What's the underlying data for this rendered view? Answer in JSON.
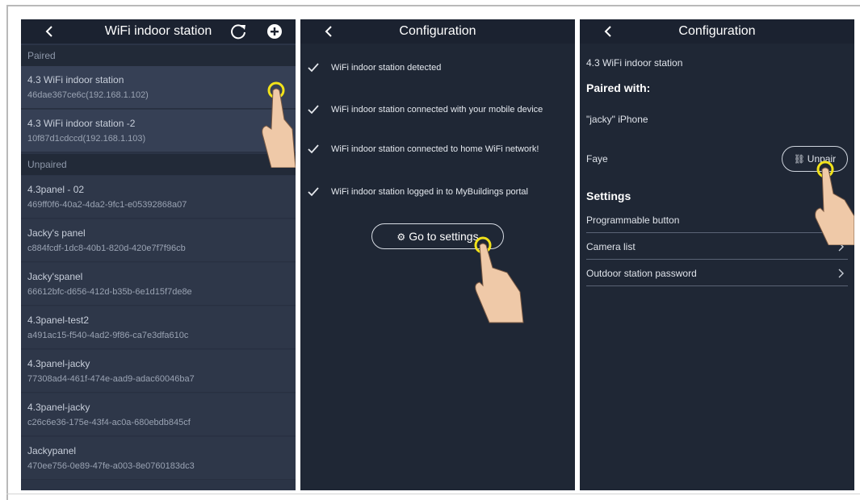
{
  "screen1": {
    "title": "WiFi indoor station",
    "paired_header": "Paired",
    "unpaired_header": "Unpaired",
    "paired": [
      {
        "name": "4.3 WiFi indoor station",
        "id": "46dae367ce6c(192.168.1.102)"
      },
      {
        "name": "4.3 WiFi indoor station -2",
        "id": "10f87d1cdccd(192.168.1.103)"
      }
    ],
    "unpaired": [
      {
        "name": "4.3panel - 02",
        "id": "469ff0f6-40a2-4da2-9fc1-e05392868a07"
      },
      {
        "name": "Jacky's panel",
        "id": "c884fcdf-1dc8-40b1-820d-420e7f7f96cb"
      },
      {
        "name": "Jacky'spanel",
        "id": "66612bfc-d656-412d-b35b-6e1d15f7de8e"
      },
      {
        "name": "4.3panel-test2",
        "id": "a491ac15-f540-4ad2-9f86-ca7e3dfa610c"
      },
      {
        "name": "4.3panel-jacky",
        "id": "77308ad4-461f-474e-aad9-adac60046ba7"
      },
      {
        "name": "4.3panel-jacky",
        "id": "c26c6e36-175e-43f4-ac0a-680ebdb845cf"
      },
      {
        "name": "Jackypanel",
        "id": "470ee756-0e89-47fe-a003-8e0760183dc3"
      }
    ]
  },
  "screen2": {
    "title": "Configuration",
    "steps": [
      "WiFi indoor station detected",
      "WiFi indoor station connected with your mobile device",
      "WiFi indoor station connected to home WiFi network!",
      "WiFi indoor station logged in to MyBuildings portal"
    ],
    "go_button": "Go to settings"
  },
  "screen3": {
    "title": "Configuration",
    "device_name": "4.3 WiFi indoor station",
    "paired_with_label": "Paired with:",
    "paired_device": "\"jacky\" iPhone",
    "user": "Faye",
    "unpair_button": "Unpair",
    "settings_label": "Settings",
    "rows": [
      "Programmable button",
      "Camera list",
      "Outdoor station password"
    ]
  },
  "colors": {
    "panel_bg": "#1f2735",
    "list_item": "#364055",
    "highlight_ring": "#f2e21a",
    "hand": "#efc9a8"
  }
}
